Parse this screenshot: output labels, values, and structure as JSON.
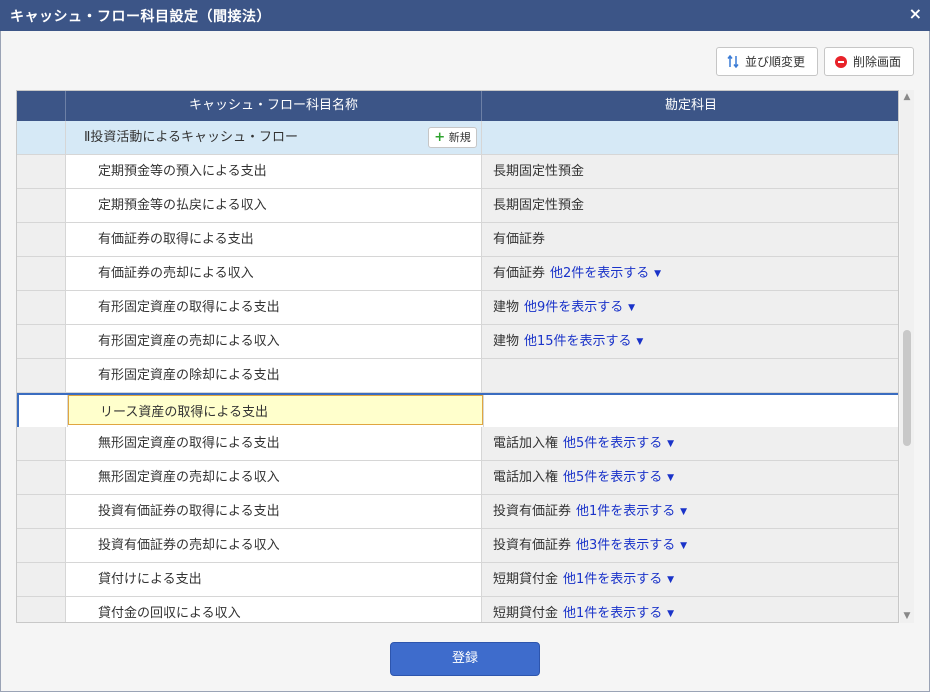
{
  "window": {
    "title": "キャッシュ・フロー科目設定（間接法）",
    "close_icon": "×"
  },
  "toolbar": {
    "sort_label": "並び順変更",
    "delete_label": "削除画面"
  },
  "grid": {
    "headers": {
      "name": "キャッシュ・フロー科目名称",
      "account": "勘定科目"
    },
    "group": {
      "label": "Ⅱ投資活動によるキャッシュ・フロー",
      "new_label": "新規"
    },
    "rows": [
      {
        "name": "定期預金等の預入による支出",
        "account": "長期固定性預金",
        "more": ""
      },
      {
        "name": "定期預金等の払戻による収入",
        "account": "長期固定性預金",
        "more": ""
      },
      {
        "name": "有価証券の取得による支出",
        "account": "有価証券",
        "more": ""
      },
      {
        "name": "有価証券の売却による収入",
        "account": "有価証券",
        "more": "他2件を表示する"
      },
      {
        "name": "有形固定資産の取得による支出",
        "account": "建物",
        "more": "他9件を表示する"
      },
      {
        "name": "有形固定資産の売却による収入",
        "account": "建物",
        "more": "他15件を表示する"
      },
      {
        "name": "有形固定資産の除却による支出",
        "account": "",
        "more": ""
      },
      {
        "name": "リース資産の取得による支出",
        "account": "",
        "more": ""
      },
      {
        "name": "無形固定資産の取得による支出",
        "account": "電話加入権",
        "more": "他5件を表示する"
      },
      {
        "name": "無形固定資産の売却による収入",
        "account": "電話加入権",
        "more": "他5件を表示する"
      },
      {
        "name": "投資有価証券の取得による支出",
        "account": "投資有価証券",
        "more": "他1件を表示する"
      },
      {
        "name": "投資有価証券の売却による収入",
        "account": "投資有価証券",
        "more": "他3件を表示する"
      },
      {
        "name": "貸付けによる支出",
        "account": "短期貸付金",
        "more": "他1件を表示する"
      },
      {
        "name": "貸付金の回収による収入",
        "account": "短期貸付金",
        "more": "他1件を表示する"
      }
    ],
    "editing_index": 7
  },
  "footer": {
    "submit_label": "登録"
  },
  "colors": {
    "header_bg": "#3c5587",
    "group_bg": "#d6e9f6",
    "link": "#1a33c9",
    "primary": "#3e6ccc"
  }
}
